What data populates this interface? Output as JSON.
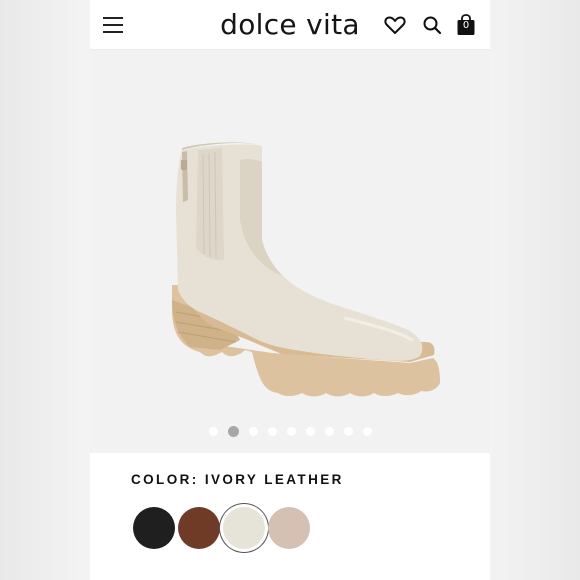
{
  "header": {
    "brand": "dolce vita",
    "icons": [
      "menu-icon",
      "heart-icon",
      "search-icon",
      "bag-icon"
    ],
    "bag_count": "0"
  },
  "gallery": {
    "image": "ivory leather chelsea-style boot with tan lug sole",
    "total_images": 9,
    "active_index": 1
  },
  "product": {
    "color_label": "COLOR:",
    "color_value": "IVORY LEATHER"
  },
  "swatches": [
    {
      "name": "black",
      "color": "#1f1f1f",
      "selected": false
    },
    {
      "name": "brown",
      "color": "#6f3b26",
      "selected": false
    },
    {
      "name": "ivory",
      "color": "#e6e3d9",
      "selected": true
    },
    {
      "name": "taupe",
      "color": "#d6c0b4",
      "selected": false
    }
  ]
}
